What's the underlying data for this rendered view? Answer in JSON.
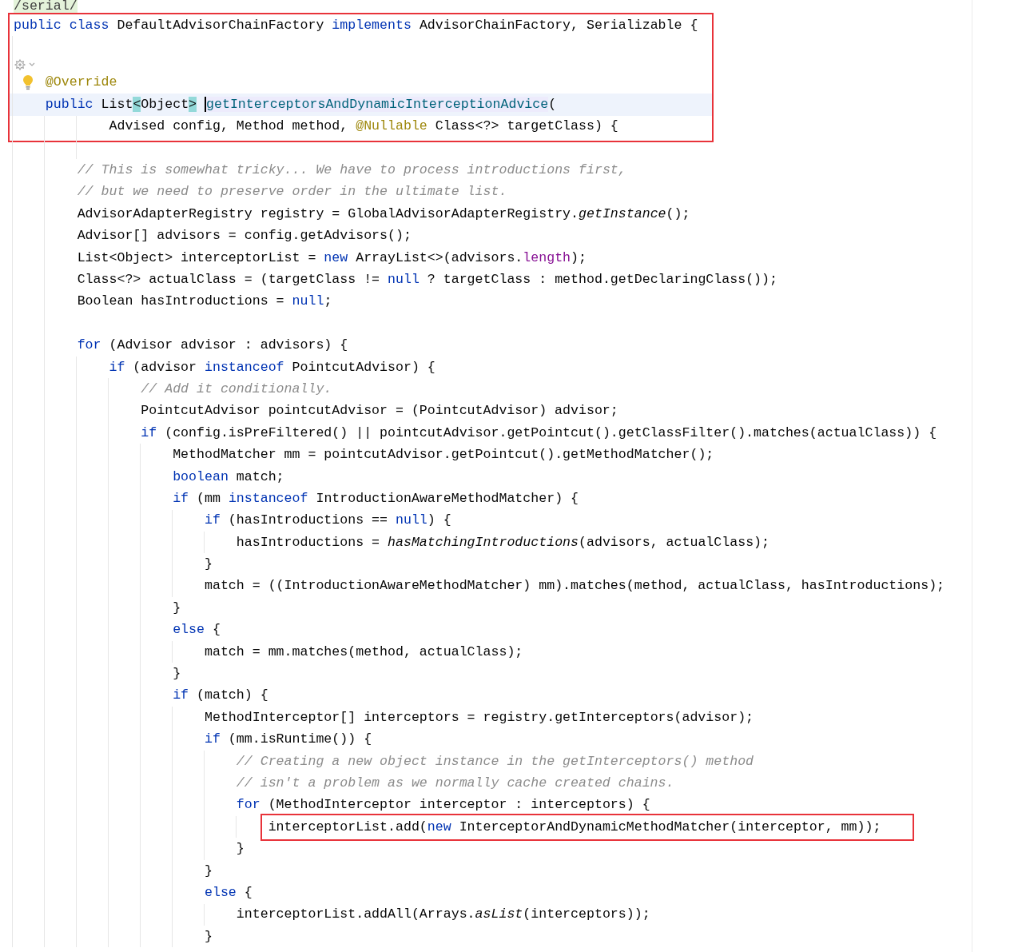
{
  "editor": {
    "lines": [
      {
        "kind": "code",
        "current": false,
        "lightbulb": false,
        "tokens": [
          {
            "kind": "tag",
            "text": "/serial/"
          }
        ]
      },
      {
        "kind": "frame",
        "lines": [
          {
            "kind": "code",
            "current": false,
            "lightbulb": false,
            "tokens": [
              {
                "kind": "keyword",
                "text": "public class "
              },
              {
                "kind": "plain",
                "text": "DefaultAdvisorChainFactory "
              },
              {
                "kind": "keyword",
                "text": "implements "
              },
              {
                "kind": "plain",
                "text": "AdvisorChainFactory, Serializable {"
              }
            ]
          },
          {
            "kind": "code",
            "current": false,
            "lightbulb": false
          },
          {
            "kind": "hint",
            "current": false,
            "lightbulb": false
          },
          {
            "kind": "code",
            "current": false,
            "lightbulb": true,
            "tokens": [
              {
                "kind": "annotation",
                "text": "    @Override"
              }
            ]
          },
          {
            "kind": "code",
            "current": true,
            "lightbulb": false,
            "tokens": [
              {
                "kind": "keyword",
                "text": "    public "
              },
              {
                "kind": "plain",
                "text": "List"
              },
              {
                "kind": "brace",
                "text": "<"
              },
              {
                "kind": "plain",
                "text": "Object"
              },
              {
                "kind": "brace",
                "text": ">"
              },
              {
                "kind": "decl",
                "caret": true,
                "text": "getInterceptorsAndDynamicInterceptionAdvice"
              },
              {
                "kind": "plain",
                "text": "("
              }
            ]
          },
          {
            "kind": "code",
            "current": false,
            "lightbulb": false,
            "tokens": [
              {
                "kind": "plain",
                "text": "            Advised config, Method method, "
              },
              {
                "kind": "annotation",
                "text": "@Nullable"
              },
              {
                "kind": "plain",
                "text": " Class<?> targetClass) {"
              }
            ]
          }
        ]
      },
      {
        "kind": "code",
        "current": false,
        "lightbulb": false
      },
      {
        "kind": "code",
        "current": false,
        "lightbulb": false,
        "tokens": [
          {
            "kind": "comment",
            "text": "        // This is somewhat tricky... We have to process introductions first,"
          }
        ]
      },
      {
        "kind": "code",
        "current": false,
        "lightbulb": false,
        "tokens": [
          {
            "kind": "comment",
            "text": "        // but we need to preserve order in the ultimate list."
          }
        ]
      },
      {
        "kind": "code",
        "current": false,
        "lightbulb": false,
        "tokens": [
          {
            "kind": "plain",
            "text": "        AdvisorAdapterRegistry registry = GlobalAdvisorAdapterRegistry."
          },
          {
            "kind": "static",
            "text": "getInstance"
          },
          {
            "kind": "plain",
            "text": "();"
          }
        ]
      },
      {
        "kind": "code",
        "current": false,
        "lightbulb": false,
        "tokens": [
          {
            "kind": "plain",
            "text": "        Advisor[] advisors = config.getAdvisors();"
          }
        ]
      },
      {
        "kind": "code",
        "current": false,
        "lightbulb": false,
        "tokens": [
          {
            "kind": "plain",
            "text": "        List<Object> interceptorList = "
          },
          {
            "kind": "keyword",
            "text": "new"
          },
          {
            "kind": "plain",
            "text": " ArrayList<>(advisors."
          },
          {
            "kind": "field",
            "text": "length"
          },
          {
            "kind": "plain",
            "text": ");"
          }
        ]
      },
      {
        "kind": "code",
        "current": false,
        "lightbulb": false,
        "tokens": [
          {
            "kind": "plain",
            "text": "        Class<?> actualClass = (targetClass != "
          },
          {
            "kind": "keyword",
            "text": "null"
          },
          {
            "kind": "plain",
            "text": " ? targetClass : method.getDeclaringClass());"
          }
        ]
      },
      {
        "kind": "code",
        "current": false,
        "lightbulb": false,
        "tokens": [
          {
            "kind": "plain",
            "text": "        Boolean hasIntroductions = "
          },
          {
            "kind": "keyword",
            "text": "null"
          },
          {
            "kind": "plain",
            "text": ";"
          }
        ]
      },
      {
        "kind": "code",
        "current": false,
        "lightbulb": false
      },
      {
        "kind": "code",
        "current": false,
        "lightbulb": false,
        "tokens": [
          {
            "kind": "keyword",
            "text": "        for"
          },
          {
            "kind": "plain",
            "text": " (Advisor advisor : advisors) {"
          }
        ]
      },
      {
        "kind": "code",
        "current": false,
        "lightbulb": false,
        "tokens": [
          {
            "kind": "keyword",
            "text": "            if"
          },
          {
            "kind": "plain",
            "text": " (advisor "
          },
          {
            "kind": "keyword",
            "text": "instanceof"
          },
          {
            "kind": "plain",
            "text": " PointcutAdvisor) {"
          }
        ]
      },
      {
        "kind": "code",
        "current": false,
        "lightbulb": false,
        "tokens": [
          {
            "kind": "comment",
            "text": "                // Add it conditionally."
          }
        ]
      },
      {
        "kind": "code",
        "current": false,
        "lightbulb": false,
        "tokens": [
          {
            "kind": "plain",
            "text": "                PointcutAdvisor pointcutAdvisor = (PointcutAdvisor) advisor;"
          }
        ]
      },
      {
        "kind": "code",
        "current": false,
        "lightbulb": false,
        "tokens": [
          {
            "kind": "keyword",
            "text": "                if"
          },
          {
            "kind": "plain",
            "text": " (config.isPreFiltered() || pointcutAdvisor.getPointcut().getClassFilter().matches(actualClass)) {"
          }
        ]
      },
      {
        "kind": "code",
        "current": false,
        "lightbulb": false,
        "tokens": [
          {
            "kind": "plain",
            "text": "                    MethodMatcher mm = pointcutAdvisor.getPointcut().getMethodMatcher();"
          }
        ]
      },
      {
        "kind": "code",
        "current": false,
        "lightbulb": false,
        "tokens": [
          {
            "kind": "keyword",
            "text": "                    boolean"
          },
          {
            "kind": "plain",
            "text": " match;"
          }
        ]
      },
      {
        "kind": "code",
        "current": false,
        "lightbulb": false,
        "tokens": [
          {
            "kind": "keyword",
            "text": "                    if"
          },
          {
            "kind": "plain",
            "text": " (mm "
          },
          {
            "kind": "keyword",
            "text": "instanceof"
          },
          {
            "kind": "plain",
            "text": " IntroductionAwareMethodMatcher) {"
          }
        ]
      },
      {
        "kind": "code",
        "current": false,
        "lightbulb": false,
        "tokens": [
          {
            "kind": "keyword",
            "text": "                        if"
          },
          {
            "kind": "plain",
            "text": " (hasIntroductions == "
          },
          {
            "kind": "keyword",
            "text": "null"
          },
          {
            "kind": "plain",
            "text": ") {"
          }
        ]
      },
      {
        "kind": "code",
        "current": false,
        "lightbulb": false,
        "tokens": [
          {
            "kind": "plain",
            "text": "                            hasIntroductions = "
          },
          {
            "kind": "static",
            "text": "hasMatchingIntroductions"
          },
          {
            "kind": "plain",
            "text": "(advisors, actualClass);"
          }
        ]
      },
      {
        "kind": "code",
        "current": false,
        "lightbulb": false,
        "tokens": [
          {
            "kind": "plain",
            "text": "                        }"
          }
        ]
      },
      {
        "kind": "code",
        "current": false,
        "lightbulb": false,
        "tokens": [
          {
            "kind": "plain",
            "text": "                        match = ((IntroductionAwareMethodMatcher) mm).matches(method, actualClass, hasIntroductions);"
          }
        ]
      },
      {
        "kind": "code",
        "current": false,
        "lightbulb": false,
        "tokens": [
          {
            "kind": "plain",
            "text": "                    }"
          }
        ]
      },
      {
        "kind": "code",
        "current": false,
        "lightbulb": false,
        "tokens": [
          {
            "kind": "keyword",
            "text": "                    else"
          },
          {
            "kind": "plain",
            "text": " {"
          }
        ]
      },
      {
        "kind": "code",
        "current": false,
        "lightbulb": false,
        "tokens": [
          {
            "kind": "plain",
            "text": "                        match = mm.matches(method, actualClass);"
          }
        ]
      },
      {
        "kind": "code",
        "current": false,
        "lightbulb": false,
        "tokens": [
          {
            "kind": "plain",
            "text": "                    }"
          }
        ]
      },
      {
        "kind": "code",
        "current": false,
        "lightbulb": false,
        "tokens": [
          {
            "kind": "keyword",
            "text": "                    if"
          },
          {
            "kind": "plain",
            "text": " (match) {"
          }
        ]
      },
      {
        "kind": "code",
        "current": false,
        "lightbulb": false,
        "tokens": [
          {
            "kind": "plain",
            "text": "                        MethodInterceptor[] interceptors = registry.getInterceptors(advisor);"
          }
        ]
      },
      {
        "kind": "code",
        "current": false,
        "lightbulb": false,
        "tokens": [
          {
            "kind": "keyword",
            "text": "                        if"
          },
          {
            "kind": "plain",
            "text": " (mm.isRuntime()) {"
          }
        ]
      },
      {
        "kind": "code",
        "current": false,
        "lightbulb": false,
        "tokens": [
          {
            "kind": "comment",
            "text": "                            // Creating a new object instance in the getInterceptors() method"
          }
        ]
      },
      {
        "kind": "code",
        "current": false,
        "lightbulb": false,
        "tokens": [
          {
            "kind": "comment",
            "text": "                            // isn't a problem as we normally cache created chains."
          }
        ]
      },
      {
        "kind": "code",
        "current": false,
        "lightbulb": false,
        "tokens": [
          {
            "kind": "keyword",
            "text": "                            for"
          },
          {
            "kind": "plain",
            "text": " (MethodInterceptor interceptor : interceptors) {"
          }
        ]
      },
      {
        "kind": "boxed",
        "current": false,
        "lightbulb": false,
        "tokens": [
          {
            "kind": "plain",
            "text": "                                interceptorList.add("
          },
          {
            "kind": "keyword",
            "text": "new"
          },
          {
            "kind": "plain",
            "text": " InterceptorAndDynamicMethodMatcher(interceptor, mm));"
          }
        ]
      },
      {
        "kind": "code",
        "current": false,
        "lightbulb": false,
        "tokens": [
          {
            "kind": "plain",
            "text": "                            }"
          }
        ]
      },
      {
        "kind": "code",
        "current": false,
        "lightbulb": false,
        "tokens": [
          {
            "kind": "plain",
            "text": "                        }"
          }
        ]
      },
      {
        "kind": "code",
        "current": false,
        "lightbulb": false,
        "tokens": [
          {
            "kind": "keyword",
            "text": "                        else"
          },
          {
            "kind": "plain",
            "text": " {"
          }
        ]
      },
      {
        "kind": "code",
        "current": false,
        "lightbulb": false,
        "tokens": [
          {
            "kind": "plain",
            "text": "                            interceptorList.addAll(Arrays."
          },
          {
            "kind": "static",
            "text": "asList"
          },
          {
            "kind": "plain",
            "text": "(interceptors));"
          }
        ]
      },
      {
        "kind": "code",
        "current": false,
        "lightbulb": false,
        "tokens": [
          {
            "kind": "plain",
            "text": "                        }"
          }
        ]
      }
    ]
  }
}
